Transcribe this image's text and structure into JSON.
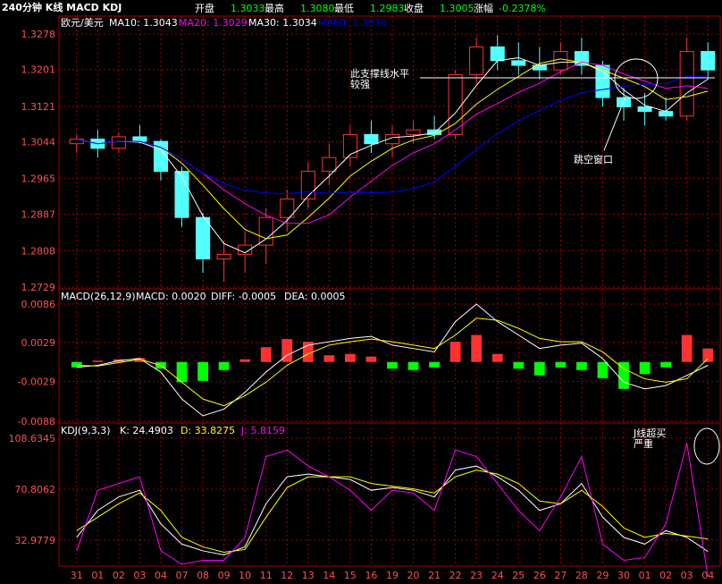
{
  "header": {
    "title": "240分钟 K线 MACD KDJ",
    "open_label": "开盘",
    "open_value": "1.3033",
    "high_label": "最高",
    "high_value": "1.3080",
    "low_label": "最低",
    "low_value": "1.2983",
    "close_label": "收盘",
    "close_value": "1.3005",
    "change_label": "涨幅",
    "change_value": "-0.2378%"
  },
  "price_panel": {
    "symbol": "欧元/美元",
    "ma10": "MA10: 1.3043",
    "ma20": "MA20: 1.3029",
    "ma30": "MA30: 1.3034",
    "ma60": "MA60: 1.3030",
    "yticks": [
      "1.3278",
      "1.3201",
      "1.3121",
      "1.3044",
      "1.2965",
      "1.2887",
      "1.2808",
      "1.2729"
    ],
    "annotation_support": "此支撑线水平较强",
    "annotation_gap": "跳空窗口"
  },
  "macd_panel": {
    "label": "MACD(26,12,9)",
    "macd": "MACD: 0.0020",
    "diff": "DIFF: -0.0005",
    "dea": "DEA: 0.0005",
    "yticks": [
      "0.0086",
      "0.0029",
      "-0.0029",
      "-0.0088"
    ]
  },
  "kdj_panel": {
    "label": "KDJ(9,3,3)",
    "k": "K: 24.4903",
    "d": "D: 33.8275",
    "j": "J: 5.8159",
    "yticks": [
      "108.6345",
      "70.8062",
      "32.9779"
    ],
    "annotation": "J线超买严重"
  },
  "xaxis": {
    "labels": [
      "31",
      "01",
      "02",
      "03",
      "04",
      "07",
      "08",
      "09",
      "10",
      "11",
      "12",
      "13",
      "14",
      "15",
      "16",
      "19",
      "20",
      "21",
      "22",
      "23",
      "24",
      "25",
      "26",
      "27",
      "28",
      "29",
      "30",
      "01",
      "02",
      "03",
      "04"
    ]
  },
  "colors": {
    "up": "#ff3232",
    "down": "#54ffff",
    "ma10": "#ffffff",
    "ma20": "#ffff00",
    "ma30": "#ff00ff",
    "ma60": "#0000ff",
    "grid": "#a00000",
    "axis_text": "#ff5050",
    "macd_pos": "#ff3232",
    "macd_neg": "#00ff00",
    "kdj_k": "#ffffff",
    "kdj_d": "#ffff00",
    "kdj_j": "#ff00ff"
  },
  "chart_data": [
    {
      "type": "candlestick",
      "title": "欧元/美元",
      "ylim": [
        1.2729,
        1.3278
      ],
      "x": [
        "31",
        "01",
        "02",
        "03",
        "04",
        "07",
        "08",
        "09",
        "10",
        "11",
        "12",
        "13",
        "14",
        "15",
        "16",
        "19",
        "20",
        "21",
        "22",
        "23",
        "24",
        "25",
        "26",
        "27",
        "28",
        "29",
        "30",
        "01",
        "02",
        "03",
        "04"
      ],
      "candles": [
        [
          1.304,
          1.306,
          1.302,
          1.305
        ],
        [
          1.305,
          1.307,
          1.301,
          1.303
        ],
        [
          1.303,
          1.3065,
          1.302,
          1.3055
        ],
        [
          1.3055,
          1.308,
          1.304,
          1.3045
        ],
        [
          1.3045,
          1.305,
          1.296,
          1.298
        ],
        [
          1.298,
          1.299,
          1.286,
          1.288
        ],
        [
          1.288,
          1.289,
          1.276,
          1.279
        ],
        [
          1.279,
          1.283,
          1.274,
          1.28
        ],
        [
          1.28,
          1.285,
          1.276,
          1.282
        ],
        [
          1.282,
          1.29,
          1.278,
          1.288
        ],
        [
          1.288,
          1.294,
          1.285,
          1.292
        ],
        [
          1.292,
          1.3,
          1.29,
          1.298
        ],
        [
          1.298,
          1.304,
          1.295,
          1.301
        ],
        [
          1.301,
          1.308,
          1.299,
          1.306
        ],
        [
          1.306,
          1.309,
          1.302,
          1.304
        ],
        [
          1.304,
          1.308,
          1.301,
          1.306
        ],
        [
          1.306,
          1.309,
          1.304,
          1.307
        ],
        [
          1.307,
          1.31,
          1.305,
          1.306
        ],
        [
          1.306,
          1.32,
          1.305,
          1.319
        ],
        [
          1.319,
          1.327,
          1.317,
          1.325
        ],
        [
          1.325,
          1.3275,
          1.32,
          1.322
        ],
        [
          1.322,
          1.326,
          1.319,
          1.321
        ],
        [
          1.321,
          1.325,
          1.318,
          1.32
        ],
        [
          1.32,
          1.326,
          1.319,
          1.324
        ],
        [
          1.324,
          1.327,
          1.319,
          1.321
        ],
        [
          1.321,
          1.322,
          1.312,
          1.314
        ],
        [
          1.314,
          1.316,
          1.309,
          1.312
        ],
        [
          1.312,
          1.315,
          1.308,
          1.311
        ],
        [
          1.311,
          1.314,
          1.309,
          1.31
        ],
        [
          1.31,
          1.327,
          1.309,
          1.324
        ],
        [
          1.324,
          1.326,
          1.318,
          1.32
        ]
      ]
    },
    {
      "type": "bar",
      "title": "MACD(26,12,9)",
      "ylim": [
        -0.0088,
        0.0086
      ],
      "x": [
        "31",
        "01",
        "02",
        "03",
        "04",
        "07",
        "08",
        "09",
        "10",
        "11",
        "12",
        "13",
        "14",
        "15",
        "16",
        "19",
        "20",
        "21",
        "22",
        "23",
        "24",
        "25",
        "26",
        "27",
        "28",
        "29",
        "30",
        "01",
        "02",
        "03",
        "04"
      ],
      "series": [
        {
          "name": "MACD",
          "values": [
            -0.0008,
            0.0002,
            0.0004,
            0.0006,
            -0.001,
            -0.003,
            -0.0028,
            -0.0012,
            0.0004,
            0.0022,
            0.0034,
            0.003,
            0.001,
            0.0012,
            0.0008,
            -0.001,
            -0.0012,
            -0.0008,
            0.003,
            0.004,
            0.0012,
            -0.001,
            -0.002,
            -0.0008,
            -0.0012,
            -0.0024,
            -0.004,
            -0.0018,
            -0.0008,
            0.004,
            0.002
          ]
        },
        {
          "name": "DIFF",
          "values": [
            -0.0008,
            -0.0005,
            0.0002,
            0.0005,
            -0.0015,
            -0.0055,
            -0.008,
            -0.007,
            -0.0045,
            -0.0015,
            0.001,
            0.0025,
            0.003,
            0.0035,
            0.0038,
            0.0025,
            0.002,
            0.0015,
            0.006,
            0.0086,
            0.006,
            0.004,
            0.002,
            0.0025,
            0.0028,
            0.0005,
            -0.003,
            -0.004,
            -0.0035,
            -0.002,
            -0.0005
          ]
        },
        {
          "name": "DEA",
          "values": [
            -0.0005,
            -0.0006,
            -0.0001,
            0.0004,
            -0.0005,
            -0.003,
            -0.0055,
            -0.0065,
            -0.005,
            -0.003,
            -0.0005,
            0.0012,
            0.0025,
            0.003,
            0.0034,
            0.003,
            0.0025,
            0.002,
            0.004,
            0.0065,
            0.0062,
            0.005,
            0.0035,
            0.003,
            0.003,
            0.0015,
            -0.001,
            -0.0025,
            -0.003,
            -0.0025,
            0.0005
          ]
        }
      ]
    },
    {
      "type": "line",
      "title": "KDJ(9,3,3)",
      "ylim": [
        15,
        108.6345
      ],
      "x": [
        "31",
        "01",
        "02",
        "03",
        "04",
        "07",
        "08",
        "09",
        "10",
        "11",
        "12",
        "13",
        "14",
        "15",
        "16",
        "19",
        "20",
        "21",
        "22",
        "23",
        "24",
        "25",
        "26",
        "27",
        "28",
        "29",
        "30",
        "01",
        "02",
        "03",
        "04"
      ],
      "series": [
        {
          "name": "K",
          "values": [
            35,
            55,
            65,
            70,
            45,
            30,
            25,
            22,
            28,
            60,
            80,
            82,
            80,
            78,
            70,
            72,
            70,
            65,
            85,
            88,
            80,
            70,
            55,
            60,
            75,
            50,
            35,
            30,
            40,
            35,
            24.49
          ]
        },
        {
          "name": "D",
          "values": [
            40,
            50,
            60,
            68,
            55,
            35,
            28,
            24,
            26,
            50,
            72,
            80,
            80,
            80,
            75,
            73,
            71,
            68,
            80,
            85,
            82,
            75,
            62,
            60,
            70,
            58,
            42,
            35,
            38,
            36,
            33.83
          ]
        },
        {
          "name": "J",
          "values": [
            25,
            70,
            75,
            80,
            25,
            15,
            18,
            18,
            35,
            95,
            100,
            88,
            80,
            70,
            55,
            70,
            68,
            55,
            100,
            95,
            75,
            55,
            40,
            65,
            95,
            30,
            18,
            20,
            45,
            105,
            5.82
          ]
        }
      ]
    }
  ]
}
